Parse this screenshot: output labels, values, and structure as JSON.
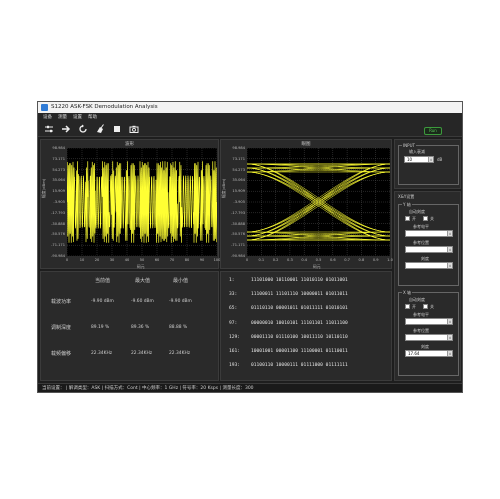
{
  "window": {
    "title": "S1220 ASK-FSK Demodulation Analysis"
  },
  "menu": [
    "设备",
    "测量",
    "设置",
    "帮助"
  ],
  "toolbar": {
    "icons": [
      "settings-sliders-icon",
      "arrow-right-icon",
      "refresh-icon",
      "broom-icon",
      "stop-square-icon",
      "camera-icon"
    ],
    "status_badge": "Run"
  },
  "waveform": {
    "title": "波形",
    "ylabel": "幅度(dBm)",
    "xlabel": "码元",
    "yticks": [
      "98.984",
      "73.171",
      "54.273",
      "35.064",
      "15.909",
      "-3.905",
      "-17.793",
      "-30.888",
      "-50.576",
      "-71.171",
      "-90.984"
    ],
    "xticks": [
      "0",
      "10",
      "20",
      "30",
      "40",
      "50",
      "60",
      "70",
      "80",
      "90",
      "100"
    ],
    "color": "#ffff33"
  },
  "eye": {
    "title": "眼图",
    "ylabel": "幅度(dBm)",
    "xlabel": "码元",
    "yticks": [
      "98.984",
      "73.171",
      "54.273",
      "35.064",
      "15.909",
      "-3.905",
      "-17.793",
      "-30.888",
      "-50.576",
      "-71.171",
      "-90.984"
    ],
    "xticks": [
      "0",
      "0.1",
      "0.2",
      "0.3",
      "0.4",
      "0.5",
      "0.6",
      "0.7",
      "0.8",
      "0.9",
      "1.0"
    ],
    "color": "#ffff33"
  },
  "stats": {
    "headers": [
      "当前值",
      "最大值",
      "最小值"
    ],
    "rows": [
      {
        "label": "载波功率",
        "values": [
          "-9.90 dBm",
          "-9.60 dBm",
          "-9.90 dBm"
        ]
      },
      {
        "label": "调制深度",
        "values": [
          "89.19 %",
          "89.36 %",
          "88.88 %"
        ]
      },
      {
        "label": "载频偏移",
        "values": [
          "22.34KHz",
          "22.34KHz",
          "22.34KHz"
        ]
      }
    ]
  },
  "bits": [
    {
      "index": "1:",
      "value": "11101000 10110001 11010110 01011001"
    },
    {
      "index": "33:",
      "value": "11100011 11101110 10000011 01011011"
    },
    {
      "index": "65:",
      "value": "01110110 00001011 01011111 01010101"
    },
    {
      "index": "97:",
      "value": "00000010 10010101 11101101 11011100"
    },
    {
      "index": "129:",
      "value": "00001110 01110100 10011110 10110110"
    },
    {
      "index": "161:",
      "value": "10001001 00001100 11100001 01110011"
    },
    {
      "index": "193:",
      "value": "01100110 10000111 01111000 01111111"
    }
  ],
  "input_panel": {
    "group": "INPUT",
    "label": "输入衰减",
    "value": "10",
    "unit": "dB"
  },
  "axis_panel": {
    "group": "X&Y设置",
    "y_group": "Y 轴",
    "y_auto": "自动刻度",
    "y_on": "开",
    "y_off": "关",
    "y_ref_label": "参考电平",
    "y_ref_value": "",
    "y_pos_label": "参考位置",
    "y_pos_value": "",
    "y_scale_label": "刻度",
    "y_scale_value": "",
    "x_group": "X 轴",
    "x_auto": "自动刻度",
    "x_on": "开",
    "x_off": "关",
    "x_ref_label": "参考电平",
    "x_ref_value": "",
    "x_pos_label": "参考位置",
    "x_pos_value": "",
    "x_scale_label": "刻度",
    "x_scale_value": "17.64"
  },
  "statusbar": {
    "text": "当前设置：  |  解调类型：ASK  |  扫描方式：Cont  |  中心频率：1 GHz  |  符号率：20 Ksps  |  测量长度：300"
  }
}
